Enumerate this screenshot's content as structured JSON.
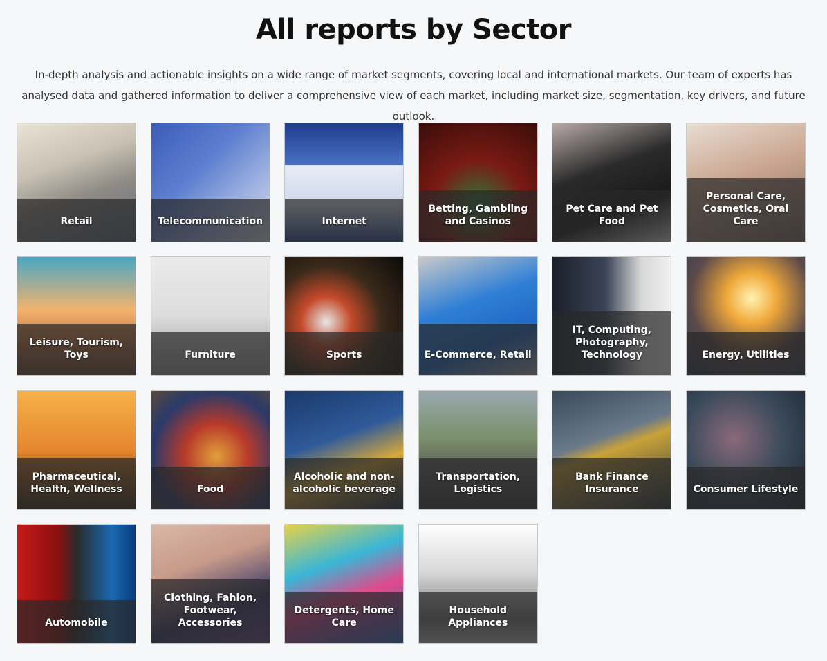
{
  "header": {
    "title": "All reports by Sector",
    "intro": "In-depth analysis and actionable insights on a wide range of market segments, covering local and international markets. Our team of experts has analysed data and gathered information to deliver a comprehensive view of each market, including market size, segmentation, key drivers, and future outlook."
  },
  "sectors": [
    {
      "label": "Retail",
      "icon": "shopping-cart-photo"
    },
    {
      "label": "Telecommunication",
      "icon": "satellite-dish-photo"
    },
    {
      "label": "Internet",
      "icon": "browser-cursor-photo"
    },
    {
      "label": "Betting, Gambling and Casinos",
      "icon": "roulette-photo"
    },
    {
      "label": "Pet Care and Pet Food",
      "icon": "cat-photo"
    },
    {
      "label": "Personal Care, Cosmetics, Oral Care",
      "icon": "facial-treatment-photo"
    },
    {
      "label": "Leisure, Tourism, Toys",
      "icon": "beach-photo"
    },
    {
      "label": "Furniture",
      "icon": "living-room-photo"
    },
    {
      "label": "Sports",
      "icon": "sports-balls-photo"
    },
    {
      "label": "E-Commerce, Retail",
      "icon": "cart-key-photo"
    },
    {
      "label": "IT, Computing, Photography, Technology",
      "icon": "server-room-photo"
    },
    {
      "label": "Energy, Utilities",
      "icon": "light-bulb-photo"
    },
    {
      "label": "Pharmaceutical, Health, Wellness",
      "icon": "runners-photo"
    },
    {
      "label": "Food",
      "icon": "burger-photo"
    },
    {
      "label": "Alcoholic and non-alcoholic beverage",
      "icon": "cocktails-photo"
    },
    {
      "label": "Transportation, Logistics",
      "icon": "highway-trucks-photo"
    },
    {
      "label": "Bank Finance Insurance",
      "icon": "credit-card-photo"
    },
    {
      "label": "Consumer Lifestyle",
      "icon": "social-icons-photo"
    },
    {
      "label": "Automobile",
      "icon": "cars-photo"
    },
    {
      "label": "Clothing, Fahion, Footwear, Accessories",
      "icon": "sneaker-photo"
    },
    {
      "label": "Detergents, Home Care",
      "icon": "cleaning-products-photo"
    },
    {
      "label": "Household Appliances",
      "icon": "appliances-photo"
    }
  ]
}
